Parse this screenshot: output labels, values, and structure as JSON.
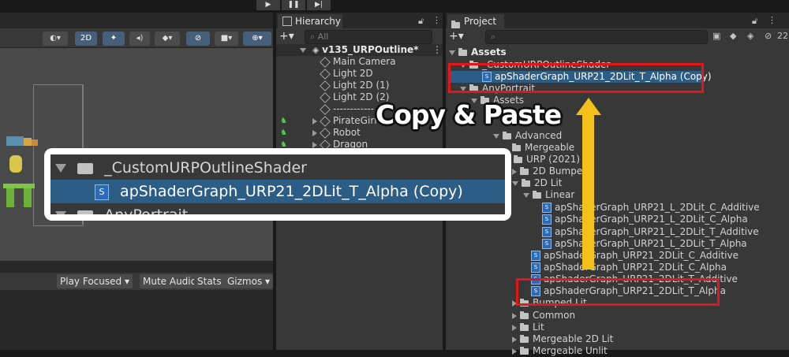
{
  "playbar": {
    "play": "▶",
    "pause": "❚❚",
    "step": "▶|"
  },
  "scene_toolbar": {
    "mode_2d": "2D"
  },
  "game_bar": {
    "play_focused": "Play Focused",
    "mute_audio": "Mute Audio",
    "stats": "Stats",
    "gizmos": "Gizmos"
  },
  "hierarchy": {
    "tab": "Hierarchy",
    "search_placeholder": "All",
    "scene_name": "v135_URPOutline*",
    "items": [
      "Main Camera",
      "Light 2D",
      "Light 2D (1)",
      "Light 2D (2)",
      "------------",
      "PirateGirl",
      "Robot",
      "Dragon"
    ]
  },
  "project": {
    "tab": "Project",
    "count_badge": "22",
    "rows": {
      "assets": "Assets",
      "custom_folder": "_CustomURPOutlineShader",
      "copy_shader": "apShaderGraph_URP21_2DLit_T_Alpha (Copy)",
      "anyportrait": "AnyPortrait",
      "sub_assets": "Assets",
      "advanced": "Advanced",
      "mergeable": "Mergeable",
      "urp2021": "URP (2021)",
      "bumped2d": "2D Bumped",
      "lit2d": "2D Lit",
      "linear": "Linear",
      "lin_c_add": "apShaderGraph_URP21_L_2DLit_C_Additive",
      "lin_c_alpha": "apShaderGraph_URP21_L_2DLit_C_Alpha",
      "lin_t_add": "apShaderGraph_URP21_L_2DLit_T_Additive",
      "lin_t_alpha": "apShaderGraph_URP21_L_2DLit_T_Alpha",
      "c_add": "apShaderGraph_URP21_2DLit_C_Additive",
      "c_alpha": "apShaderGraph_URP21_2DLit_C_Alpha",
      "t_add": "apShaderGraph_URP21_2DLit_T_Additive",
      "t_alpha": "apShaderGraph_URP21_2DLit_T_Alpha",
      "bumped_lit": "Bumped Lit",
      "common": "Common",
      "lit": "Lit",
      "mergeable2d": "Mergeable 2D Lit",
      "mergeable_unlit": "Mergeable Unlit"
    }
  },
  "callout": {
    "folder": "_CustomURPOutlineShader",
    "file": "apShaderGraph_URP21_2DLit_T_Alpha (Copy)",
    "folder2": "AnyPortrait"
  },
  "annotation": {
    "copy_paste": "Copy & Paste",
    "arrow_color": "#f4c01a",
    "box_color": "#e3161c"
  }
}
